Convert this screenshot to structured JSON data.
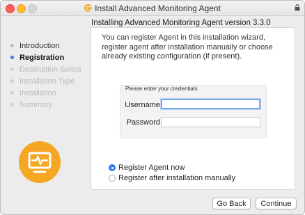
{
  "window": {
    "title": "Install Advanced Monitoring Agent",
    "subtitle": "Installing Advanced Monitoring Agent version 3.3.0"
  },
  "steps": [
    {
      "label": "Introduction",
      "state": "done"
    },
    {
      "label": "Registration",
      "state": "active"
    },
    {
      "label": "Destination Select",
      "state": "pending"
    },
    {
      "label": "Installation Type",
      "state": "pending"
    },
    {
      "label": "Installation",
      "state": "pending"
    },
    {
      "label": "Summary",
      "state": "pending"
    }
  ],
  "panel": {
    "description": "You can register Agent in this installation wizard, register agent after installation manually or choose already existing configuration (if present).",
    "credentials_title": "Please enter your credentials",
    "username_label": "Username",
    "username_value": "",
    "password_label": "Password",
    "password_value": "",
    "options": [
      {
        "label": "Register Agent now",
        "checked": true
      },
      {
        "label": "Register after installation manually",
        "checked": false
      }
    ]
  },
  "buttons": {
    "back": "Go Back",
    "continue": "Continue"
  },
  "colors": {
    "accent": "#2f7cf6",
    "brand": "#f5a623"
  },
  "icons": {
    "title": "agent-app-icon",
    "lock": "lock-icon",
    "logo": "monitor-pulse-icon"
  }
}
